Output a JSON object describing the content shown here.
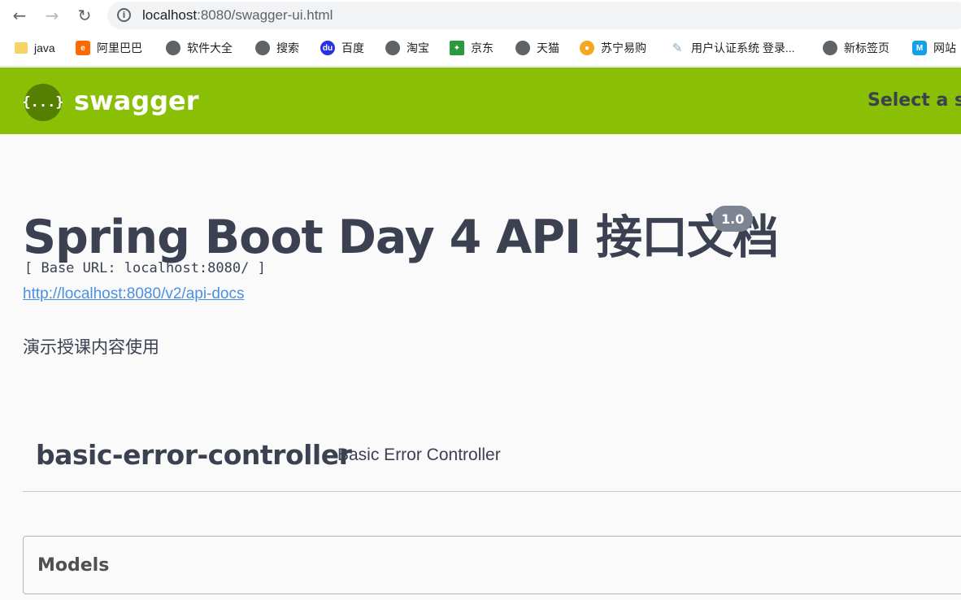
{
  "browser": {
    "url_host": "localhost",
    "url_rest": ":8080/swagger-ui.html",
    "bookmarks": [
      {
        "label": "java",
        "icon": "folder-icon"
      },
      {
        "label": "阿里巴巴",
        "icon": "alibaba-icon"
      },
      {
        "label": "软件大全",
        "icon": "globe-icon"
      },
      {
        "label": "搜索",
        "icon": "globe-icon"
      },
      {
        "label": "百度",
        "icon": "baidu-icon"
      },
      {
        "label": "淘宝",
        "icon": "globe-icon"
      },
      {
        "label": "京东",
        "icon": "jd-icon"
      },
      {
        "label": "天猫",
        "icon": "globe-icon"
      },
      {
        "label": "苏宁易购",
        "icon": "suning-icon"
      },
      {
        "label": "用户认证系统 登录...",
        "icon": "feather-icon"
      },
      {
        "label": "新标签页",
        "icon": "globe-icon"
      },
      {
        "label": "网站",
        "icon": "m-icon"
      }
    ]
  },
  "topbar": {
    "logo_glyph": "{...}",
    "logo_text": "swagger",
    "spec_select_label": "Select a sp",
    "background": "#89bf04"
  },
  "info": {
    "title": "Spring Boot Day 4 API 接口文档",
    "version": "1.0",
    "base_url": "[ Base URL: localhost:8080/ ]",
    "docs_link": "http://localhost:8080/v2/api-docs",
    "description": "演示授课内容使用"
  },
  "tag": {
    "name": "basic-error-controller",
    "description": "Basic Error Controller"
  },
  "models": {
    "title": "Models"
  },
  "colors": {
    "accent": "#89bf04",
    "text": "#3b4151",
    "link": "#4990e2",
    "version_badge": "#7d8492"
  }
}
